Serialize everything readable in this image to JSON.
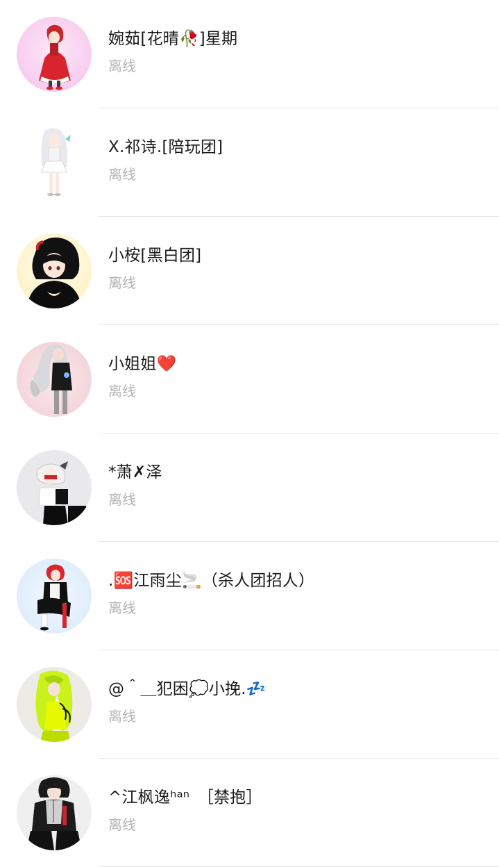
{
  "contacts": [
    {
      "name": "婉茹[花晴🥀]星期",
      "status": "离线",
      "avatar": "red-dress-girl-avatar"
    },
    {
      "name": "X.祁诗.[陪玩团]",
      "status": "离线",
      "avatar": "white-hair-girl-avatar"
    },
    {
      "name": "小桉[黑白团]",
      "status": "离线",
      "avatar": "black-hood-girl-avatar"
    },
    {
      "name": "小姐姐❤️",
      "status": "离线",
      "avatar": "silver-hair-girl-avatar"
    },
    {
      "name": "*萧✗泽",
      "status": "离线",
      "avatar": "masked-boy-avatar"
    },
    {
      "name": ".🆘江雨尘🚬（杀人团招人）",
      "status": "离线",
      "avatar": "red-hair-boy-avatar"
    },
    {
      "name": "@＾＿犯困💭小挽.💤",
      "status": "离线",
      "avatar": "green-hair-girl-avatar"
    },
    {
      "name": "^江枫逸ʰᵃⁿ　［禁抱］",
      "status": "离线",
      "avatar": "grey-hoodie-boy-avatar"
    }
  ],
  "colors": {
    "name_text": "#1a1a1a",
    "status_text": "#b4b4b4",
    "divider": "#e6e6e6",
    "background": "#ffffff"
  }
}
